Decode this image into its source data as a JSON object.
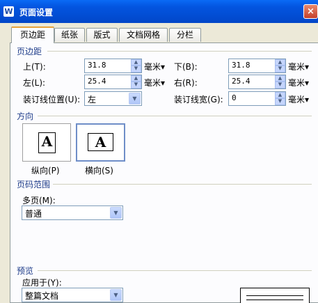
{
  "window": {
    "title": "页面设置",
    "app_icon": "W",
    "close": "×"
  },
  "tabs": [
    "页边距",
    "纸张",
    "版式",
    "文档网格",
    "分栏"
  ],
  "margins": {
    "section_title": "页边距",
    "top_label": "上(T):",
    "top_value": "31.8",
    "bottom_label": "下(B):",
    "bottom_value": "31.8",
    "left_label": "左(L):",
    "left_value": "25.4",
    "right_label": "右(R):",
    "right_value": "25.4",
    "gutter_pos_label": "装订线位置(U):",
    "gutter_pos_value": "左",
    "gutter_width_label": "装订线宽(G):",
    "gutter_width_value": "0",
    "unit": "毫米▾"
  },
  "orientation": {
    "section_title": "方向",
    "portrait_label": "纵向(P)",
    "landscape_label": "横向(S)",
    "glyph": "A",
    "selected": "landscape"
  },
  "pages": {
    "section_title": "页码范围",
    "multiple_label": "多页(M):",
    "multiple_value": "普通"
  },
  "preview": {
    "section_title": "预览",
    "apply_label": "应用于(Y):",
    "apply_value": "整篇文档"
  },
  "icons": {
    "spin_up": "▲",
    "spin_down": "▼",
    "dropdown": "▼"
  }
}
